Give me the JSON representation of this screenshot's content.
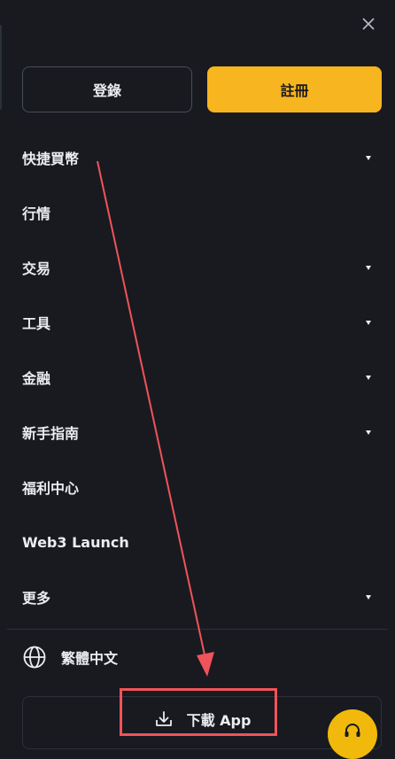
{
  "header": {
    "close_icon": "close-icon",
    "login_label": "登錄",
    "register_label": "註冊"
  },
  "menu": {
    "items": [
      {
        "label": "快捷買幣",
        "has_caret": true
      },
      {
        "label": "行情",
        "has_caret": false
      },
      {
        "label": "交易",
        "has_caret": true
      },
      {
        "label": "工具",
        "has_caret": true
      },
      {
        "label": "金融",
        "has_caret": true
      },
      {
        "label": "新手指南",
        "has_caret": true
      },
      {
        "label": "福利中心",
        "has_caret": false
      },
      {
        "label": "Web3 Launch",
        "has_caret": false
      },
      {
        "label": "更多",
        "has_caret": true
      }
    ]
  },
  "language": {
    "icon": "globe-icon",
    "label": "繁體中文"
  },
  "download": {
    "icon": "download-icon",
    "label": "下載 App"
  },
  "support": {
    "icon": "headset-icon"
  },
  "colors": {
    "background": "#181a20",
    "accent": "#f7b51f",
    "annotation": "#f0535a",
    "text": "#eaecef"
  }
}
